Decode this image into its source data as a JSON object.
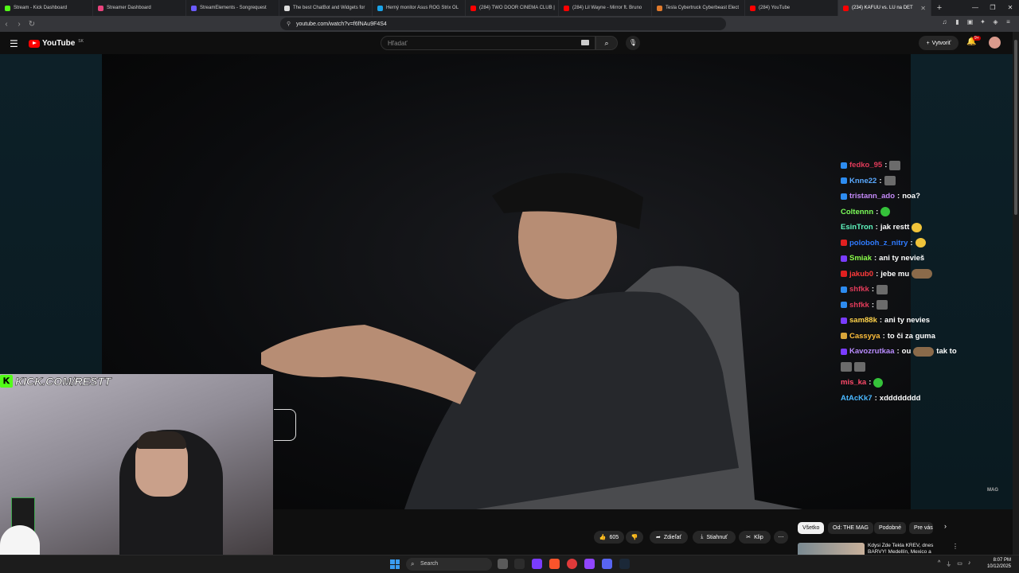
{
  "browser": {
    "tabs": [
      {
        "label": "Stream - Kick Dashboard",
        "color": "#53fc18"
      },
      {
        "label": "Streamer Dashboard",
        "color": "#e9437d"
      },
      {
        "label": "StreamElements - Songrequest",
        "color": "#6b5bff"
      },
      {
        "label": "The best ChatBot and Widgets for",
        "color": "#dddddd"
      },
      {
        "label": "Herný monitor Asus ROG Strix OL",
        "color": "#1aa3e8"
      },
      {
        "label": "(284) TWO DOOR CINEMA CLUB |",
        "color": "#ff0000"
      },
      {
        "label": "(284) Lil Wayne - Mirror ft. Bruno",
        "color": "#ff0000"
      },
      {
        "label": "Tesla Cybertruck Cyberbeast Elect",
        "color": "#e07a2c"
      },
      {
        "label": "(284) YouTube",
        "color": "#ff0000"
      },
      {
        "label": "(234) KAFUU vs. LU na DET",
        "color": "#ff0000"
      }
    ],
    "new_tab": "+",
    "url": "youtube.com/watch?v=f6fNAu9F4S4"
  },
  "youtube": {
    "logo_text": "YouTube",
    "region": "SK",
    "search_placeholder": "Hľadať",
    "create_label": "Vytvoriť",
    "notification_count": "9+"
  },
  "chat": [
    {
      "user": "fedko_95",
      "color": "#e23b5a",
      "msg": "",
      "emotes": [
        "tile"
      ],
      "badge": "#2d8cf0"
    },
    {
      "user": "Knne22",
      "color": "#5aa9ff",
      "msg": "",
      "emotes": [
        "tile"
      ],
      "badge": "#2d8cf0"
    },
    {
      "user": "tristann_ado",
      "color": "#c58af9",
      "msg": "noa?",
      "emotes": [],
      "badge": "#2d8cf0"
    },
    {
      "user": "Coltennn",
      "color": "#7cff5a",
      "msg": "",
      "emotes": [
        "green"
      ],
      "badge": ""
    },
    {
      "user": "EsinTron",
      "color": "#5ff7c0",
      "msg": "jak restt",
      "emotes": [
        "yellow"
      ],
      "badge": ""
    },
    {
      "user": "poloboh_z_nitry",
      "color": "#2f7bff",
      "msg": "",
      "emotes": [
        "yellow"
      ],
      "badge": "#e02020"
    },
    {
      "user": "Smiak",
      "color": "#8bff4a",
      "msg": "ani ty nevieš",
      "emotes": [],
      "badge": "#7a3cff"
    },
    {
      "user": "jakub0",
      "color": "#ff3b3b",
      "msg": "jebe mu",
      "emotes": [
        "long"
      ],
      "badge": "#e02020"
    },
    {
      "user": "shfkk",
      "color": "#e23b5a",
      "msg": "",
      "emotes": [
        "tile"
      ],
      "badge": "#2d8cf0"
    },
    {
      "user": "shfkk",
      "color": "#e23b5a",
      "msg": "",
      "emotes": [
        "tile"
      ],
      "badge": "#2d8cf0"
    },
    {
      "user": "sam88k",
      "color": "#ffd24a",
      "msg": "ani ty nevies",
      "emotes": [],
      "badge": "#7a3cff"
    },
    {
      "user": "Cassyya",
      "color": "#ffbf3b",
      "msg": "to či za guma",
      "emotes": [],
      "badge": "#d9a53a"
    },
    {
      "user": "Kavozrutkaa",
      "color": "#b98cff",
      "msg": "ou",
      "emotes": [
        "long"
      ],
      "msg2": "tak to",
      "badge": "#7a3cff"
    },
    {
      "user": "",
      "color": "#ffffff",
      "msg": "",
      "emotes": [
        "tile",
        "tile"
      ],
      "badge": ""
    },
    {
      "user": "mis_ka",
      "color": "#ff4a6a",
      "msg": "",
      "emotes": [
        "green"
      ],
      "badge": ""
    },
    {
      "user": "AtAcKk7",
      "color": "#4ab8ff",
      "msg": "xdddddddd",
      "emotes": [],
      "badge": ""
    }
  ],
  "overlay": {
    "kick_url": "KICK.COM/RESTT",
    "watermark": "MAG"
  },
  "actions": {
    "likes": "605",
    "share": "Zdieľať",
    "download": "Stiahnuť",
    "clip": "Klip",
    "more": "⋯"
  },
  "chips": [
    "Všetko",
    "Od: THE MAG",
    "Podobné",
    "Pre vás"
  ],
  "recommendation": {
    "title": "Kdysi Zde Tekla KREV, dnes BARVY! Medellín, Mexico a"
  },
  "taskbar": {
    "search": "Search",
    "time": "8:07 PM",
    "date": "10/12/2025"
  }
}
